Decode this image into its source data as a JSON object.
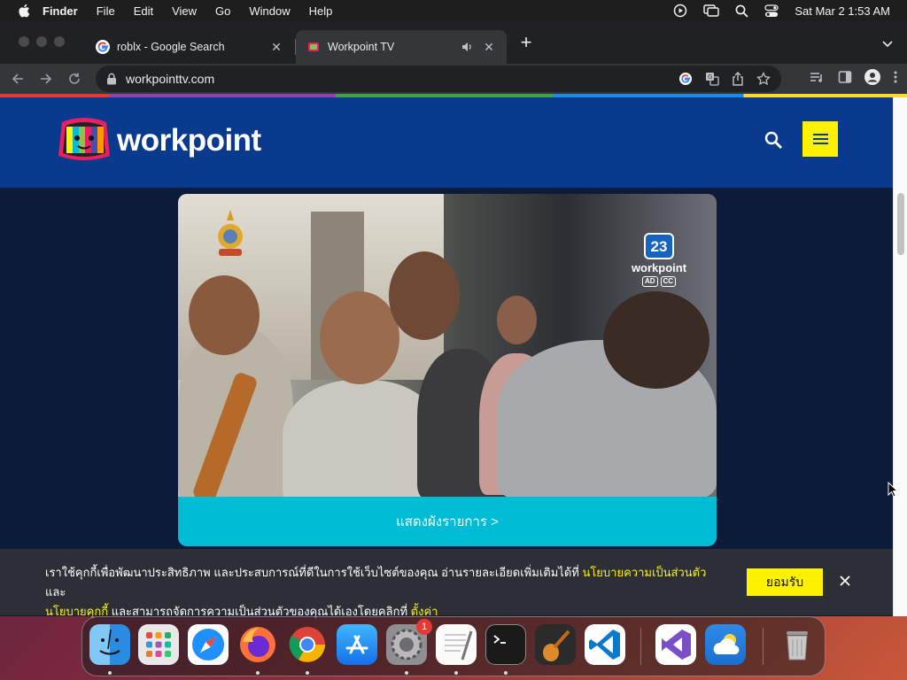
{
  "menubar": {
    "app_name": "Finder",
    "items": [
      "File",
      "Edit",
      "View",
      "Go",
      "Window",
      "Help"
    ],
    "status_icons": [
      "play-circle-icon",
      "screen-mirroring-icon",
      "spotlight-search-icon",
      "control-center-icon"
    ],
    "clock": "Sat Mar 2  1:53 AM"
  },
  "browser": {
    "tabs": [
      {
        "title": "roblx - Google Search",
        "favicon": "google-icon",
        "active": false
      },
      {
        "title": "Workpoint TV",
        "favicon": "workpoint-icon",
        "active": true,
        "playing_audio": true
      }
    ],
    "url": "workpointtv.com"
  },
  "site": {
    "logo_text": "workpoint",
    "schedule_button": "แสดงผังรายการ >",
    "channel_logo": {
      "number": "23",
      "name": "workpoint",
      "badges": [
        "AD",
        "CC"
      ]
    }
  },
  "cookie_banner": {
    "text_1": "เราใช้คุกกี้เพื่อพัฒนาประสิทธิภาพ และประสบการณ์ที่ดีในการใช้เว็บไซต์ของคุณ อ่านรายละเอียดเพิ่มเติมได้ที่ ",
    "link_privacy": "นโยบายความเป็นส่วนตัว",
    "text_2": " และ",
    "link_cookie": "นโยบายคุกกี้",
    "text_3": " และสามารถจัดการความเป็นส่วนตัวของคุณได้เองโดยคลิกที่ ",
    "link_settings": "ตั้งค่า",
    "accept_label": "ยอมรับ"
  },
  "dock": {
    "apps": [
      "Finder",
      "Launchpad",
      "Safari",
      "Firefox",
      "Google Chrome",
      "App Store",
      "System Preferences",
      "TextEdit",
      "Terminal",
      "GarageBand",
      "Visual Studio Code",
      "Visual Studio",
      "Weather",
      "Trash"
    ],
    "system_preferences_badge": "1"
  },
  "colors": {
    "site_header": "#0a3a8e",
    "accent_yellow": "#fff200",
    "schedule_button": "#00bcd4"
  }
}
